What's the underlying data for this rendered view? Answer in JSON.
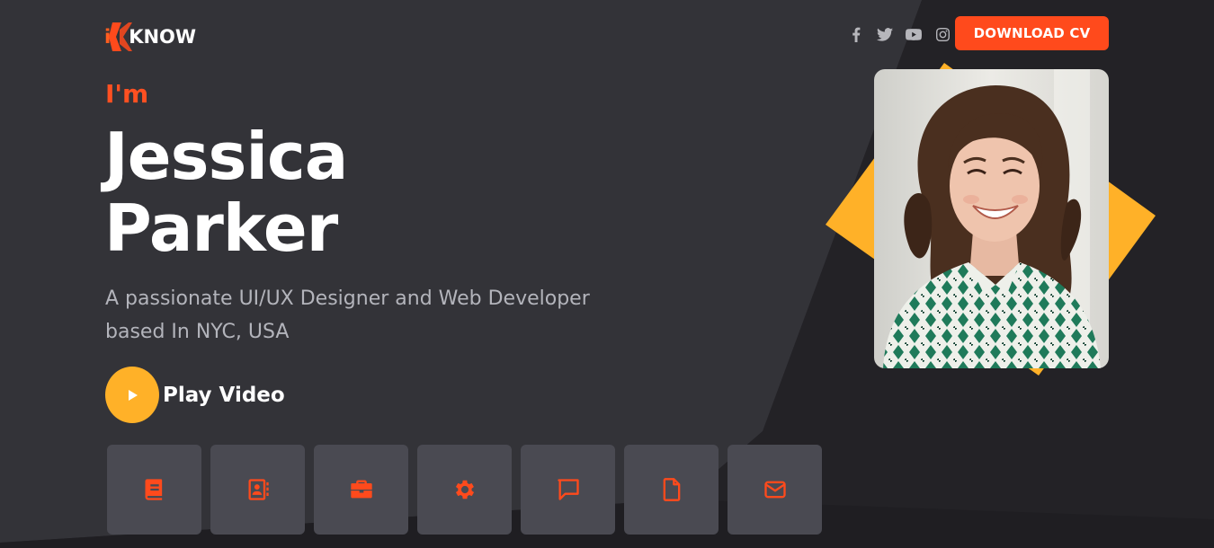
{
  "brand": {
    "logo_prefix": "i",
    "logo_text": "KNOW"
  },
  "header": {
    "socials": [
      {
        "icon": "facebook-icon"
      },
      {
        "icon": "twitter-icon"
      },
      {
        "icon": "youtube-icon"
      },
      {
        "icon": "instagram-icon"
      }
    ],
    "cta_label": "DOWNLOAD CV"
  },
  "hero": {
    "greeting": "I'm",
    "first_name": "Jessica",
    "last_name": "Parker",
    "description": "A passionate UI/UX Designer and Web Developer based In NYC, USA",
    "play_label": "Play Video"
  },
  "nav_tiles": [
    {
      "icon": "book-icon"
    },
    {
      "icon": "contact-book-icon"
    },
    {
      "icon": "briefcase-icon"
    },
    {
      "icon": "gear-icon"
    },
    {
      "icon": "chat-icon"
    },
    {
      "icon": "document-icon"
    },
    {
      "icon": "envelope-icon"
    }
  ],
  "colors": {
    "accent": "#ff4a1c",
    "yellow": "#ffb128",
    "panel_dark": "#333338",
    "bg_dark": "#232226",
    "tile": "#4a4a52"
  }
}
